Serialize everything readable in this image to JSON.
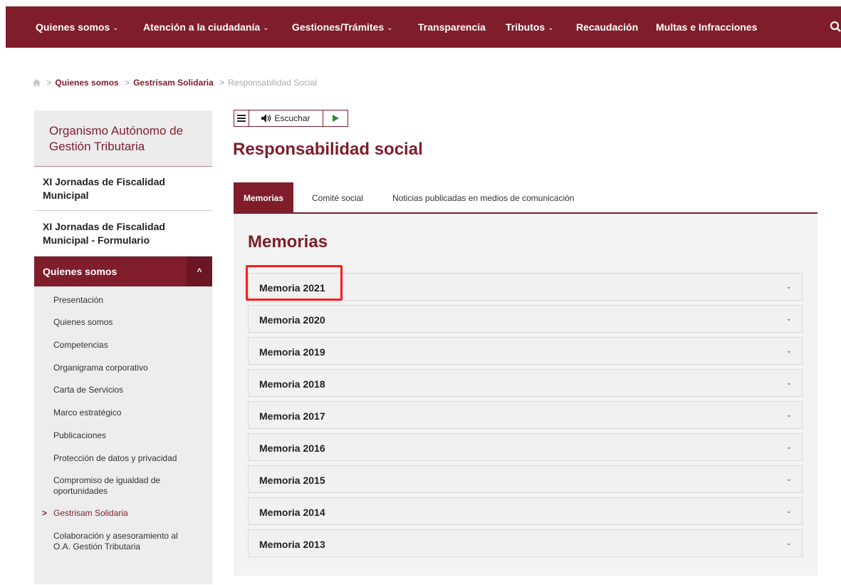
{
  "nav": {
    "items": [
      {
        "label": "Quienes somos",
        "has_dropdown": true
      },
      {
        "label": "Atención a la ciudadanía",
        "has_dropdown": true
      },
      {
        "label": "Gestiones/Trámites",
        "has_dropdown": true
      },
      {
        "label": "Transparencia",
        "has_dropdown": false
      },
      {
        "label": "Tributos",
        "has_dropdown": true
      },
      {
        "label": "Recaudación",
        "has_dropdown": false
      },
      {
        "label": "Multas e Infracciones",
        "has_dropdown": false
      }
    ],
    "chevron": "⌄",
    "search_icon": "search-icon"
  },
  "breadcrumb": {
    "home_icon": "home-icon",
    "items": [
      "Quienes somos",
      "Gestrisam Solidaria"
    ],
    "current": "Responsabilidad Social"
  },
  "sidebar": {
    "org_title": "Organismo Autónomo de Gestión Tributaria",
    "links": [
      "XI Jornadas de Fiscalidad Municipal",
      "XI Jornadas de Fiscalidad Municipal - Formulario"
    ],
    "section": {
      "label": "Quienes somos",
      "toggle": "^"
    },
    "items": [
      {
        "label": "Presentación"
      },
      {
        "label": "Quienes somos"
      },
      {
        "label": "Competencias"
      },
      {
        "label": "Organigrama corporativo"
      },
      {
        "label": "Carta de Servicios"
      },
      {
        "label": "Marco estratégico"
      },
      {
        "label": "Publicaciones"
      },
      {
        "label": "Protección de datos y privacidad"
      },
      {
        "label": "Compromiso de igualdad de oportunidades"
      },
      {
        "label": "Gestrisam Solidaria",
        "active": true
      },
      {
        "label": "Colaboración y asesoramiento al O.A. Gestión Tributaria"
      }
    ],
    "active_marker": ">"
  },
  "reader": {
    "menu_icon": "menu-icon",
    "speaker_icon": "speaker-icon",
    "listen_label": "Escuchar",
    "play_icon": "play-icon"
  },
  "page_title": "Responsabilidad social",
  "tabs": [
    {
      "label": "Memorias",
      "active": true
    },
    {
      "label": "Comité social"
    },
    {
      "label": "Noticias publicadas en medios de comunicación"
    }
  ],
  "content": {
    "heading": "Memorias",
    "accordions": [
      "Memoria 2021",
      "Memoria 2020",
      "Memoria 2019",
      "Memoria 2018",
      "Memoria 2017",
      "Memoria 2016",
      "Memoria 2015",
      "Memoria 2014",
      "Memoria 2013"
    ],
    "chevron": "⌄"
  },
  "colors": {
    "brand": "#7f1d2b",
    "highlight": "#ff1a1a"
  }
}
